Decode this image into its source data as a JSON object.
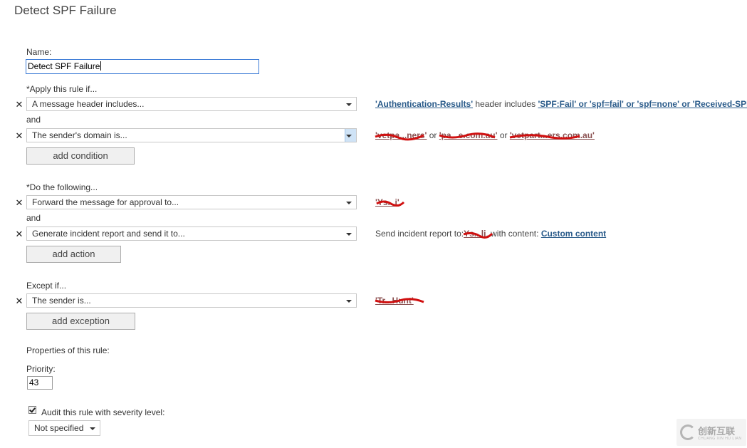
{
  "page": {
    "title": "Detect SPF Failure"
  },
  "name": {
    "label": "Name:",
    "value": "Detect SPF Failure"
  },
  "conditions": {
    "label": "*Apply this rule if...",
    "rows": [
      {
        "select": "A message header includes...",
        "desc_parts": [
          "'Authentication-Results'",
          " header includes ",
          "'SPF:Fail' or 'spf=fail' or 'spf=none' or 'Received-SPF:Fail'"
        ]
      },
      {
        "select": "The sender's domain is...",
        "desc_redacted": [
          "'vetpa...ners'",
          " or ",
          "'pa...e.com.au'",
          " or ",
          "'vetpart...ers.com.au'"
        ]
      }
    ],
    "and": "and",
    "add_button": "add condition"
  },
  "actions": {
    "label": "*Do the following...",
    "rows": [
      {
        "select": "Forward the message for approval to...",
        "desc_redacted": "'Ys...i'"
      },
      {
        "select": "Generate incident report and send it to...",
        "desc_prefix": "Send incident report to:",
        "desc_redacted": "Ys...li",
        "desc_mid": ", with content: ",
        "desc_link": "Custom content"
      }
    ],
    "and": "and",
    "add_button": "add action"
  },
  "exceptions": {
    "label": "Except if...",
    "rows": [
      {
        "select": "The sender is...",
        "desc_redacted": "'Tr...Hunt'"
      }
    ],
    "add_button": "add exception"
  },
  "properties": {
    "label": "Properties of this rule:",
    "priority_label": "Priority:",
    "priority_value": "43",
    "audit_label": "Audit this rule with severity level:",
    "audit_checked": true,
    "severity_value": "Not specified"
  },
  "watermark": {
    "text": "创新互联",
    "sub": "CHUANG XIN HU LIAN"
  },
  "colors": {
    "link": "#2a5b8a",
    "redaction": "#d01010",
    "focus_border": "#3b7bd6"
  }
}
